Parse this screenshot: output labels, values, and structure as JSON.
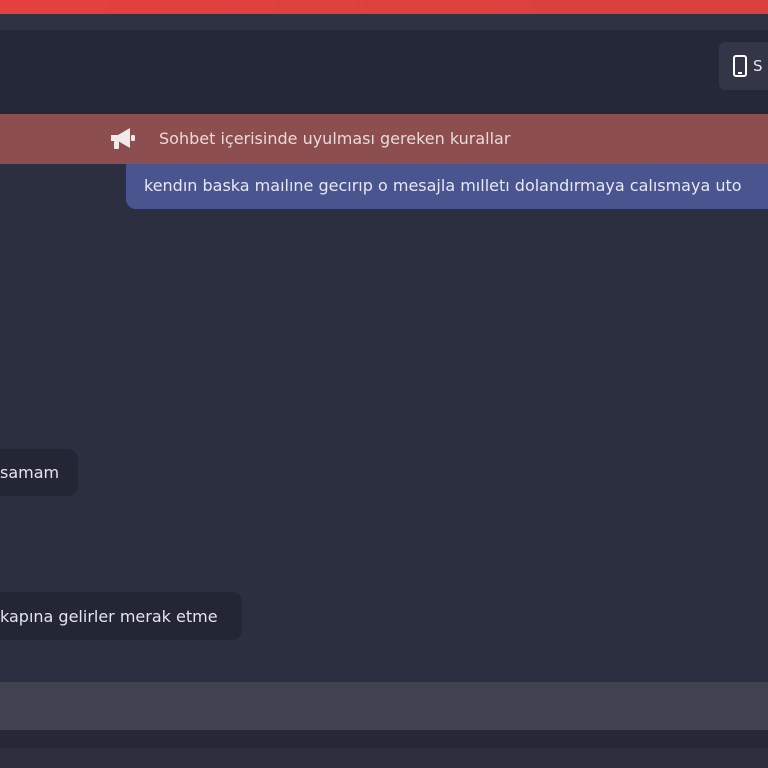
{
  "header": {
    "app_button_label": "S"
  },
  "rules": {
    "banner_text": "Sohbet içerisinde uyulması gereken kurallar",
    "message_text": "kendın baska maılıne gecırıp o mesajla mılletı dolandırmaya calısmaya uto"
  },
  "chat": {
    "messages": [
      {
        "text": "samam"
      },
      {
        "text": "kapına gelirler merak etme"
      }
    ]
  },
  "colors": {
    "accent_red": "#e5403d",
    "rules_banner": "#8c4e4f",
    "rules_message": "#4a5590"
  }
}
